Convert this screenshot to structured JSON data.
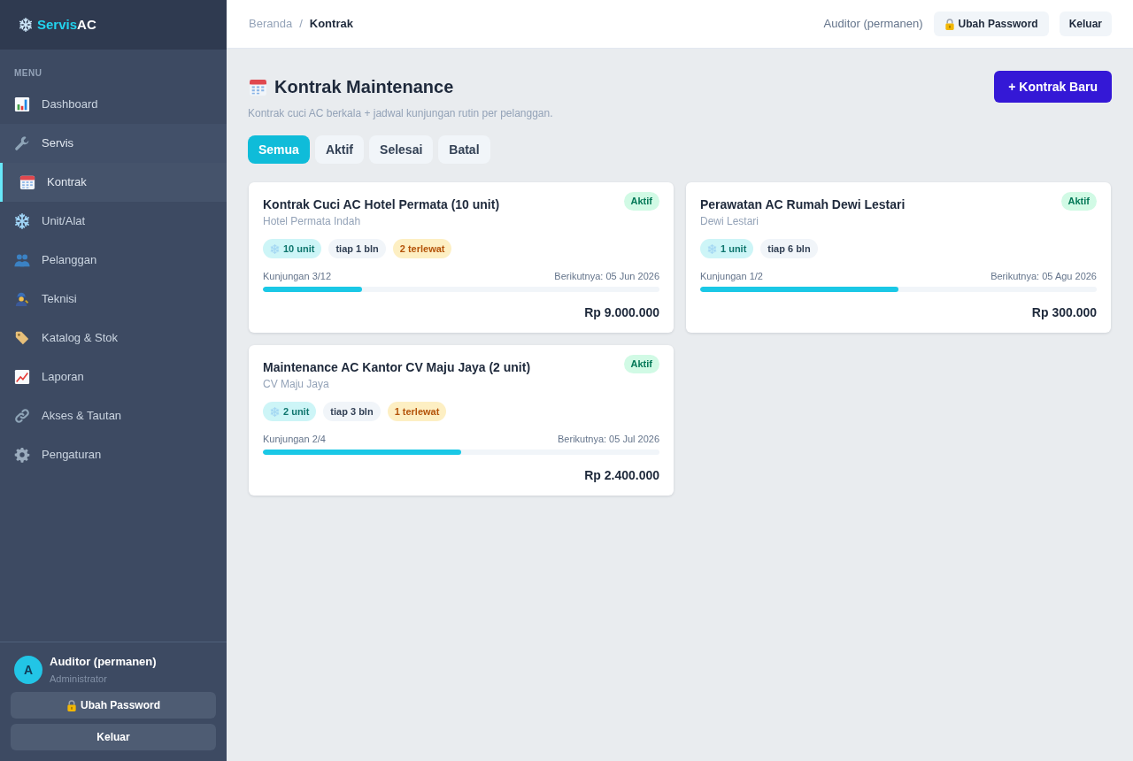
{
  "sidebar": {
    "logo": {
      "part_1": "Servis",
      "part_2": "AC"
    },
    "section_label": "MENU",
    "items": [
      {
        "label": "Dashboard",
        "selected": false,
        "hovered": false
      },
      {
        "label": "Servis",
        "selected": false,
        "hovered": true
      },
      {
        "label": "Kontrak",
        "selected": true,
        "hovered": false
      },
      {
        "label": "Unit/Alat",
        "selected": false,
        "hovered": false
      },
      {
        "label": "Pelanggan",
        "selected": false,
        "hovered": false
      },
      {
        "label": "Teknisi",
        "selected": false,
        "hovered": false
      },
      {
        "label": "Katalog & Stok",
        "selected": false,
        "hovered": false
      },
      {
        "label": "Laporan",
        "selected": false,
        "hovered": false
      },
      {
        "label": "Akses & Tautan",
        "selected": false,
        "hovered": false
      },
      {
        "label": "Pengaturan",
        "selected": false,
        "hovered": false
      }
    ],
    "user": {
      "avatar_initial": "A",
      "name": "Auditor (permanen)",
      "role": "Administrator"
    },
    "buttons": [
      {
        "kind": "password",
        "label": "Ubah Password"
      },
      {
        "kind": "logout",
        "label": "Keluar"
      }
    ]
  },
  "topbar": {
    "breadcrumb": [
      {
        "label": "Beranda",
        "current": false
      },
      {
        "label": "Kontrak",
        "current": true
      }
    ],
    "separator": "/",
    "user_label": "Auditor (permanen)",
    "buttons": [
      {
        "kind": "password",
        "label": "Ubah Password"
      },
      {
        "kind": "logout",
        "label": "Keluar"
      }
    ]
  },
  "page": {
    "title": "Kontrak Maintenance",
    "subtitle": "Kontrak cuci AC berkala + jadwal kunjungan rutin per pelanggan.",
    "new_button": "+ Kontrak Baru",
    "tabs": [
      {
        "label": "Semua",
        "selected": true
      },
      {
        "label": "Aktif",
        "selected": false
      },
      {
        "label": "Selesai",
        "selected": false
      },
      {
        "label": "Batal",
        "selected": false
      }
    ],
    "contracts": [
      {
        "title": "Kontrak Cuci AC Hotel Permata (10 unit)",
        "customer": "Hotel Permata Indah",
        "status": {
          "kind": "active",
          "label": "Aktif"
        },
        "tags": [
          {
            "kind": "units",
            "label": "10 unit"
          },
          {
            "kind": "interval",
            "label": "tiap 1 bln"
          },
          {
            "kind": "overdue",
            "label": "2 terlewat"
          }
        ],
        "progress_label": "Kunjungan 3/12",
        "next_visit": "Berikutnya: 05 Jun 2026",
        "level": 0.25,
        "price": "Rp 9.000.000"
      },
      {
        "title": "Perawatan AC Rumah Dewi Lestari",
        "customer": "Dewi Lestari",
        "status": {
          "kind": "active",
          "label": "Aktif"
        },
        "tags": [
          {
            "kind": "units",
            "label": "1 unit"
          },
          {
            "kind": "interval",
            "label": "tiap 6 bln"
          }
        ],
        "progress_label": "Kunjungan 1/2",
        "next_visit": "Berikutnya: 05 Agu 2026",
        "level": 0.5,
        "price": "Rp 300.000"
      },
      {
        "title": "Maintenance AC Kantor CV Maju Jaya (2 unit)",
        "customer": "CV Maju Jaya",
        "status": {
          "kind": "active",
          "label": "Aktif"
        },
        "tags": [
          {
            "kind": "units",
            "label": "2 unit"
          },
          {
            "kind": "interval",
            "label": "tiap 3 bln"
          },
          {
            "kind": "overdue",
            "label": "1 terlewat"
          }
        ],
        "progress_label": "Kunjungan 2/4",
        "next_visit": "Berikutnya: 05 Jul 2026",
        "level": 0.5,
        "price": "Rp 2.400.000"
      }
    ]
  }
}
